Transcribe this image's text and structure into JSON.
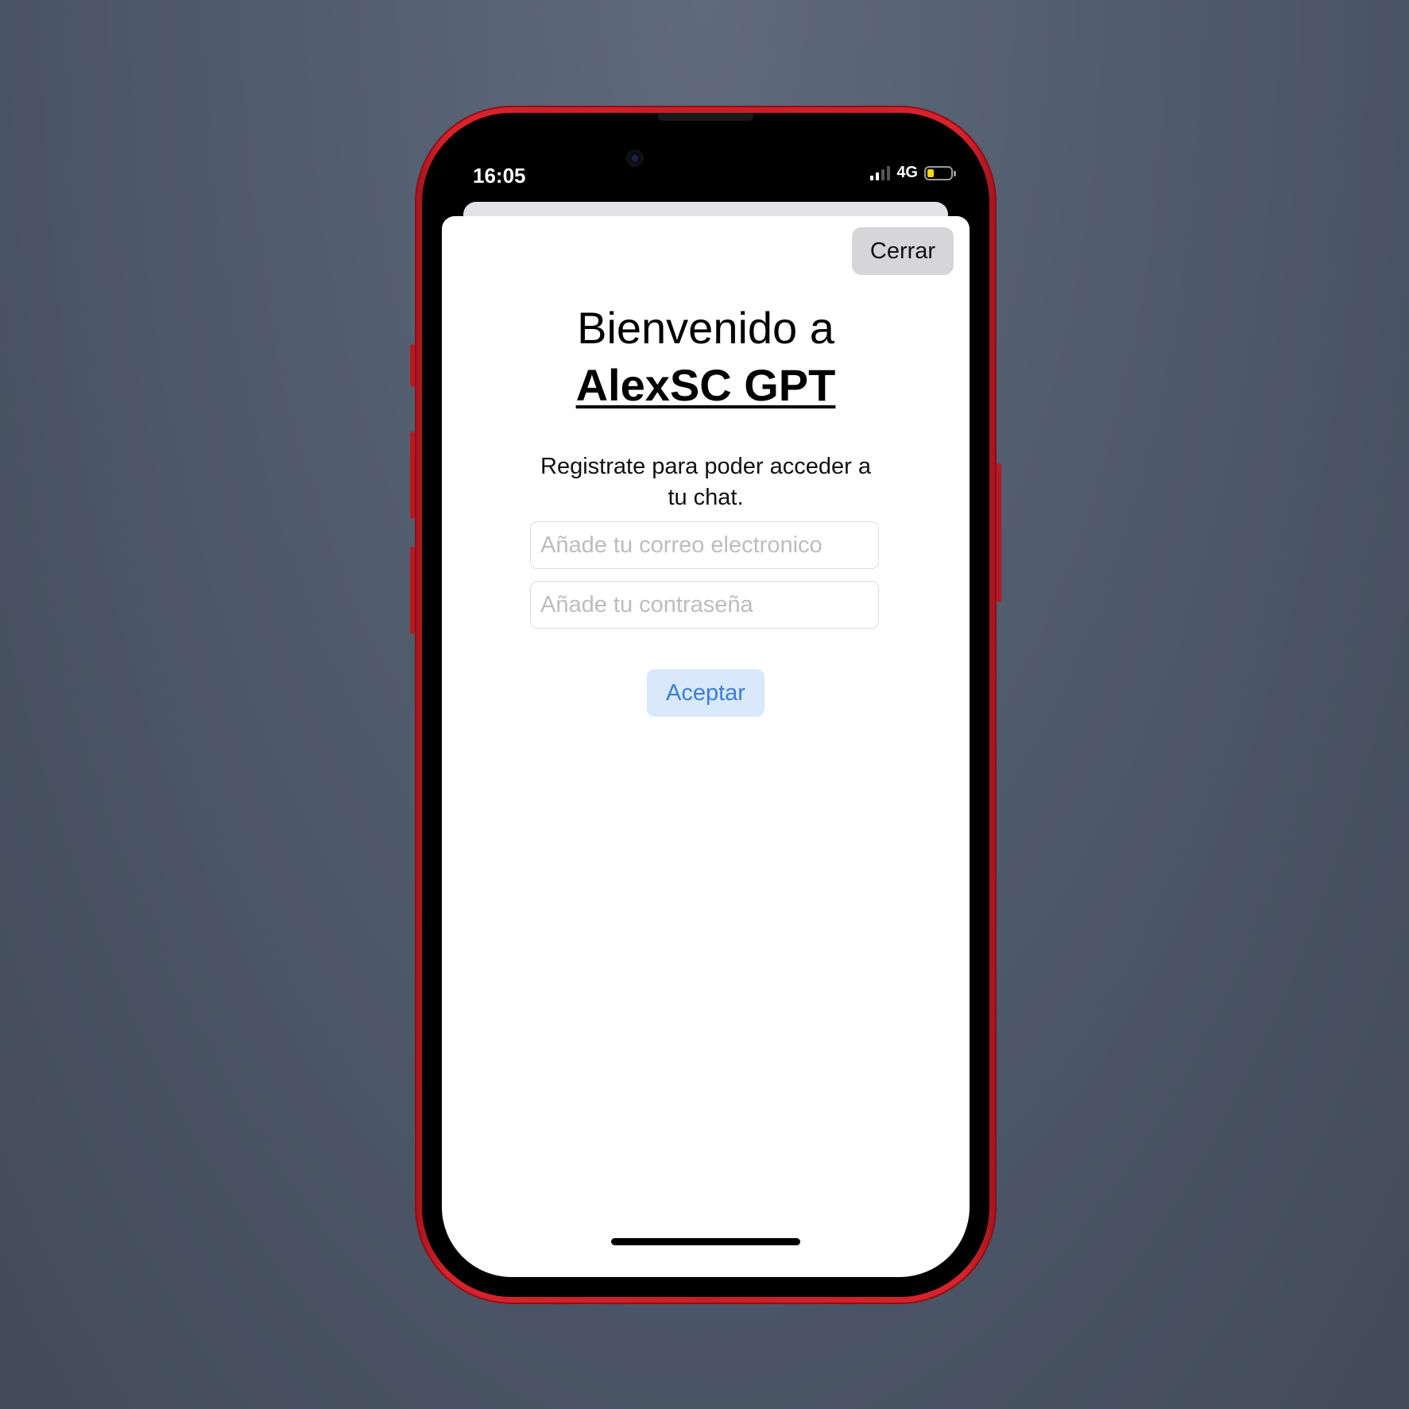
{
  "status_bar": {
    "time": "16:05",
    "network": "4G",
    "signal_bars_active": 2,
    "signal_bars_total": 4,
    "battery_level": 0.3,
    "battery_color": "#ffd60a"
  },
  "sheet": {
    "close_label": "Cerrar",
    "title_line1": "Bienvenido a",
    "title_line2": "AlexSC GPT",
    "subtitle": "Registrate para poder acceder a tu chat.",
    "email_placeholder": "Añade tu correo electronico",
    "email_value": "",
    "password_placeholder": "Añade tu contraseña",
    "password_value": "",
    "accept_label": "Aceptar"
  },
  "colors": {
    "phone_frame": "#c81d27",
    "accept_bg": "#d9e8fb",
    "accept_text": "#3a7fd5",
    "close_bg": "#d6d6d8"
  }
}
